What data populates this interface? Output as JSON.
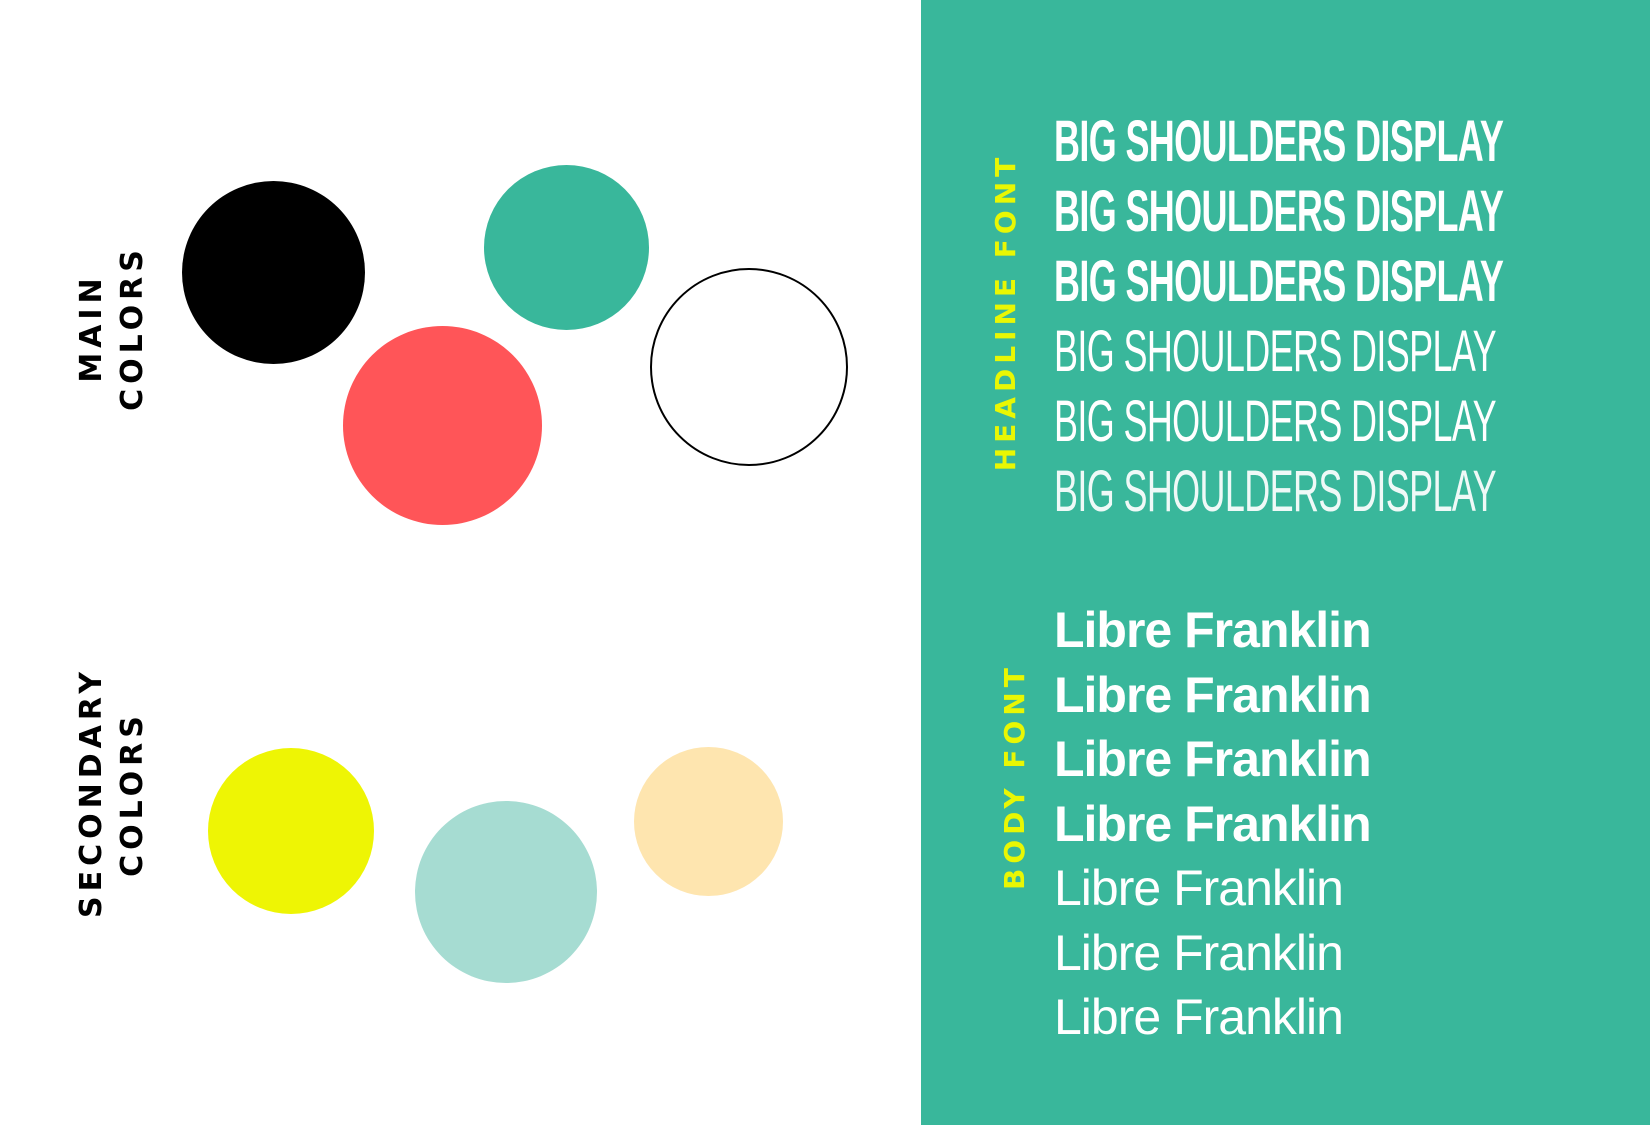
{
  "colors": {
    "panel": "#39b79b",
    "label_accent": "#e9f703",
    "on_panel_text": "#ffffff",
    "ink": "#000000"
  },
  "main_colors": {
    "label_line1": "MAIN",
    "label_line2": "COLORS",
    "swatches": [
      {
        "name": "black",
        "hex": "#000000"
      },
      {
        "name": "teal",
        "hex": "#39b79b"
      },
      {
        "name": "coral",
        "hex": "#ff5558"
      },
      {
        "name": "white",
        "hex": "#ffffff"
      }
    ]
  },
  "secondary_colors": {
    "label_line1": "SECONDARY",
    "label_line2": "COLORS",
    "swatches": [
      {
        "name": "yellow",
        "hex": "#eef504"
      },
      {
        "name": "mint",
        "hex": "#a6dcd2"
      },
      {
        "name": "peach",
        "hex": "#fee5af"
      }
    ]
  },
  "headline_font": {
    "label": "HEADLINE FONT",
    "samples": [
      "BIG SHOULDERS DISPLAY",
      "BIG SHOULDERS DISPLAY",
      "BIG SHOULDERS DISPLAY",
      "BIG SHOULDERS DISPLAY",
      "BIG SHOULDERS DISPLAY",
      "BIG SHOULDERS DISPLAY"
    ]
  },
  "body_font": {
    "label": "BODY FONT",
    "samples": [
      "Libre Franklin",
      "Libre Franklin",
      "Libre Franklin",
      "Libre Franklin",
      "Libre Franklin",
      "Libre Franklin",
      "Libre Franklin"
    ]
  }
}
